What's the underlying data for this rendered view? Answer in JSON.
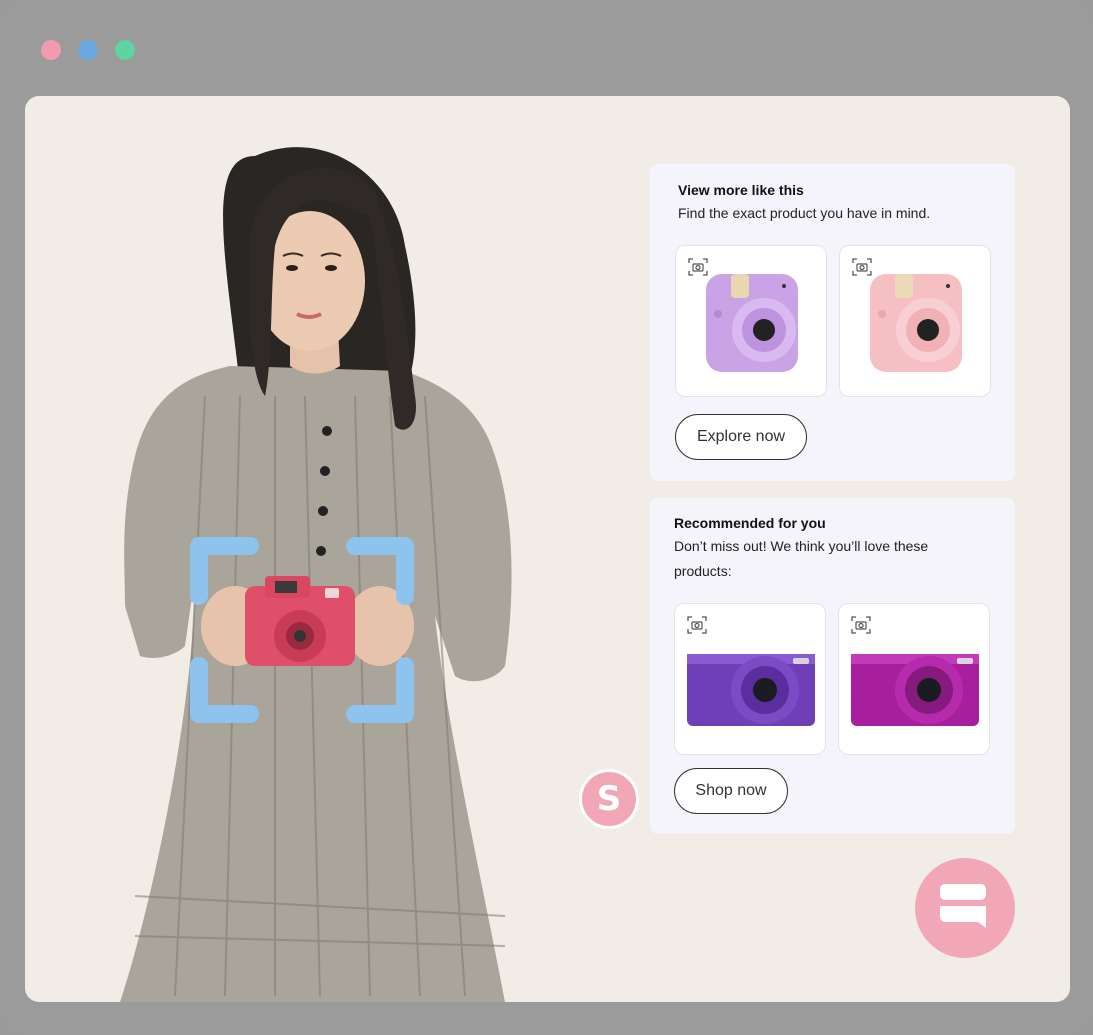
{
  "window": {
    "controls": [
      {
        "name": "close",
        "color": "#f29bb0"
      },
      {
        "name": "minimize",
        "color": "#6aa8e0"
      },
      {
        "name": "maximize",
        "color": "#5fd3a1"
      }
    ]
  },
  "scan_frame": {
    "color": "#8ec3ee"
  },
  "cards": [
    {
      "title": "View more like this",
      "subtitle": "Find the exact product you have in mind.",
      "products": [
        {
          "name": "purple-instant-camera",
          "icon": "camera-search-icon"
        },
        {
          "name": "pink-instant-camera",
          "icon": "camera-search-icon"
        }
      ],
      "button_label": "Explore now"
    },
    {
      "title": "Recommended for you",
      "subtitle_line1": "Don’t miss out! We think you’ll love these",
      "subtitle_line2": "products:",
      "products": [
        {
          "name": "purple-compact-camera",
          "icon": "camera-search-icon"
        },
        {
          "name": "magenta-compact-camera",
          "icon": "camera-search-icon"
        }
      ],
      "button_label": "Shop now"
    }
  ],
  "badge": {
    "letter": "S",
    "color": "#f2a7b6"
  },
  "chat": {
    "icon": "chat-bubble-icon",
    "color": "#f2a7b6"
  }
}
